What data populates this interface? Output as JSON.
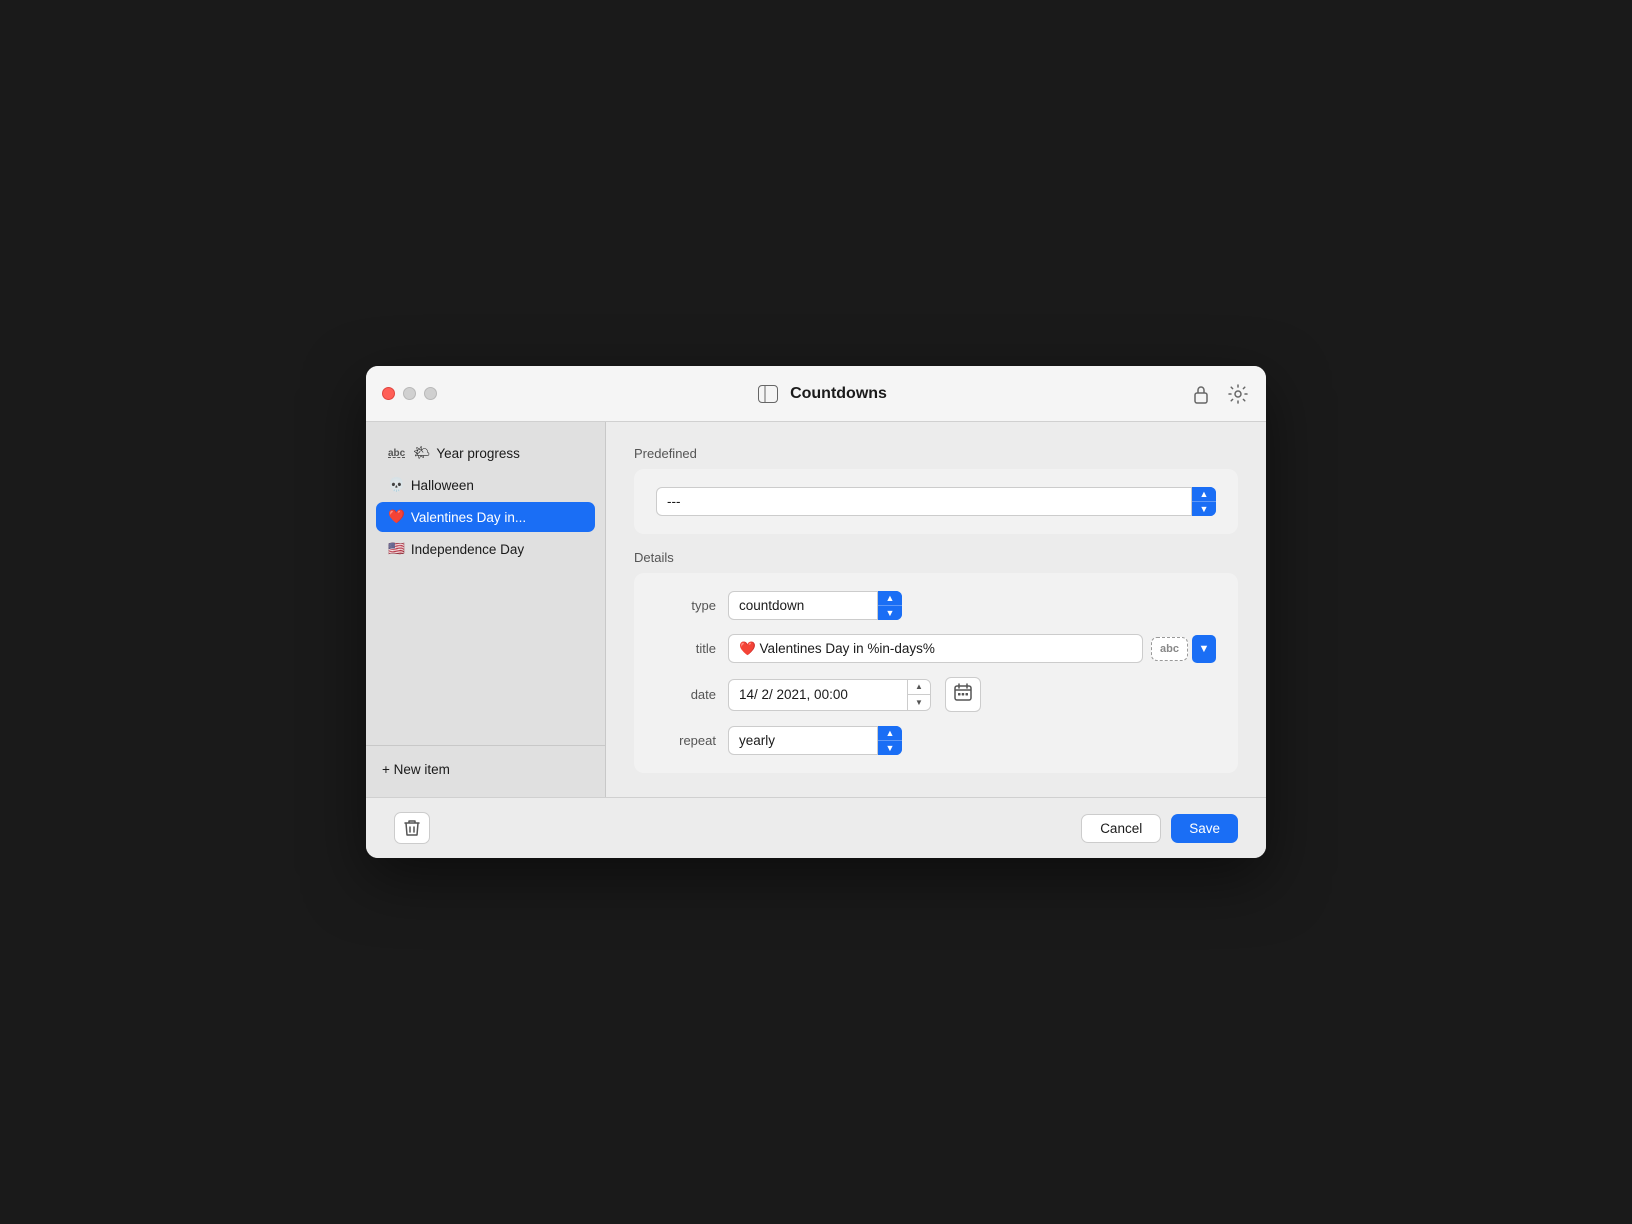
{
  "window": {
    "title": "Countdowns"
  },
  "sidebar": {
    "items": [
      {
        "id": "year-progress",
        "emoji": "🌤",
        "abc": "abc",
        "label": "Year progress",
        "active": false
      },
      {
        "id": "halloween",
        "emoji": "💀",
        "label": "Halloween",
        "active": false
      },
      {
        "id": "valentines",
        "emoji": "❤️",
        "label": "Valentines Day in...",
        "active": true
      },
      {
        "id": "independence",
        "emoji": "🇺🇸",
        "label": "Independence Day",
        "active": false
      }
    ],
    "new_item_label": "+ New item"
  },
  "detail": {
    "predefined_label": "Predefined",
    "predefined_value": "---",
    "details_label": "Details",
    "type_label": "type",
    "type_value": "countdown",
    "title_label": "title",
    "title_value": "❤️ Valentines Day in %in-days%",
    "date_label": "date",
    "date_value": "14/ 2/ 2021, 00:00",
    "repeat_label": "repeat",
    "repeat_value": "yearly"
  },
  "toolbar": {
    "cancel_label": "Cancel",
    "save_label": "Save"
  },
  "icons": {
    "sidebar_toggle": "⊞",
    "lock": "🔓",
    "gear": "⚙️",
    "delete": "🗑",
    "calendar": "📅",
    "chevron_up": "▲",
    "chevron_down": "▼"
  }
}
